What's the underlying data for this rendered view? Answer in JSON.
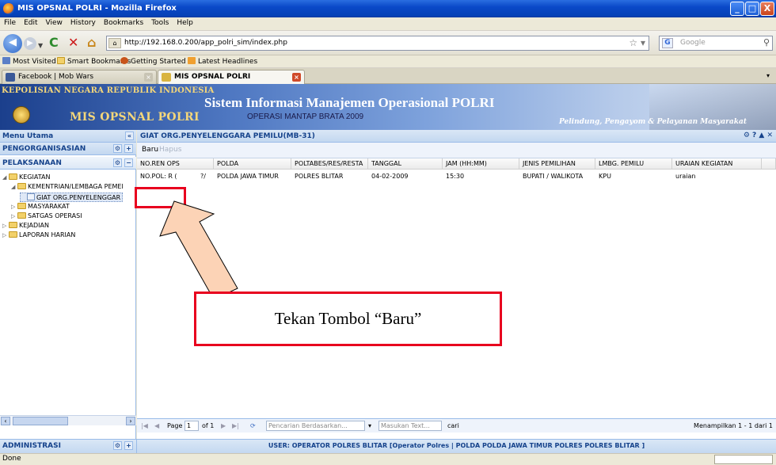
{
  "window": {
    "title": "MIS OPSNAL POLRI - Mozilla Firefox",
    "buttons": [
      "_",
      "□",
      "X"
    ]
  },
  "menubar": [
    "File",
    "Edit",
    "View",
    "History",
    "Bookmarks",
    "Tools",
    "Help"
  ],
  "navbar": {
    "url": "http://192.168.0.200/app_polri_sim/index.php",
    "search_placeholder": "Google"
  },
  "bookmarks": [
    "Most Visited",
    "Smart Bookmarks",
    "Getting Started",
    "Latest Headlines"
  ],
  "tabs": [
    {
      "label": "Facebook | Mob Wars",
      "active": false
    },
    {
      "label": "MIS OPSNAL POLRI",
      "active": true
    }
  ],
  "header": {
    "org": "KEPOLISIAN NEGARA REPUBLIK INDONESIA",
    "app": "MIS OPSNAL POLRI",
    "system_title": "Sistem Informasi Manajemen Operasional POLRI",
    "operation": "OPERASI MANTAP BRATA 2009",
    "motto": "Pelindung, Pengayom & Pelayanan Masyarakat"
  },
  "sidebar": {
    "title": "Menu Utama",
    "sections": [
      "PENGORGANISASIAN",
      "PELAKSANAAN"
    ],
    "tree": [
      {
        "label": "KEGIATAN",
        "level": 0,
        "expanded": true
      },
      {
        "label": "KEMENTRIAN/LEMBAGA PEMEI",
        "level": 1,
        "expanded": true
      },
      {
        "label": "GIAT ORG.PENYELENGGAR",
        "level": 2,
        "leaf": true
      },
      {
        "label": "MASYARAKAT",
        "level": 1
      },
      {
        "label": "SATGAS OPERASI",
        "level": 1
      },
      {
        "label": "KEJADIAN",
        "level": 0
      },
      {
        "label": "LAPORAN HARIAN",
        "level": 0
      }
    ],
    "bottom": "ADMINISTRASI"
  },
  "main": {
    "title": "GIAT ORG.PENYELENGGARA PEMILU(MB-31)",
    "tool_icons": "⚙ ? ▲ ✕",
    "toolbar": {
      "new": "Baru",
      "delete": "Hapus"
    },
    "columns": [
      "NO.REN OPS",
      "POLDA",
      "POLTABES/RES/RESTA",
      "TANGGAL",
      "JAM (HH:MM)",
      "JENIS PEMILIHAN",
      "LMBG. PEMILU",
      "URAIAN KEGIATAN"
    ],
    "rows": [
      [
        "NO.POL: R (",
        "POLDA JAWA TIMUR",
        "POLRES BLITAR",
        "04-02-2009",
        "15:30",
        "BUPATI / WALIKOTA",
        "KPU",
        "uraian"
      ]
    ],
    "row_overlap_fragment": "?/",
    "pager": {
      "page_label": "Page",
      "page_value": "1",
      "of_label": "of 1",
      "search_by_placeholder": "Pencarian Berdasarkan...",
      "search_text_placeholder": "Masukan Text...",
      "search_button": "cari",
      "summary": "Menampilkan 1 - 1 dari 1"
    },
    "footer": "USER: OPERATOR POLRES BLITAR [Operator Polres | POLDA POLDA JAWA TIMUR POLRES POLRES BLITAR ]"
  },
  "status": "Done",
  "annotation": {
    "callout": "Tekan Tombol “Baru”",
    "arrow_color": "#fcd3b6",
    "box_color": "#e8001e"
  }
}
